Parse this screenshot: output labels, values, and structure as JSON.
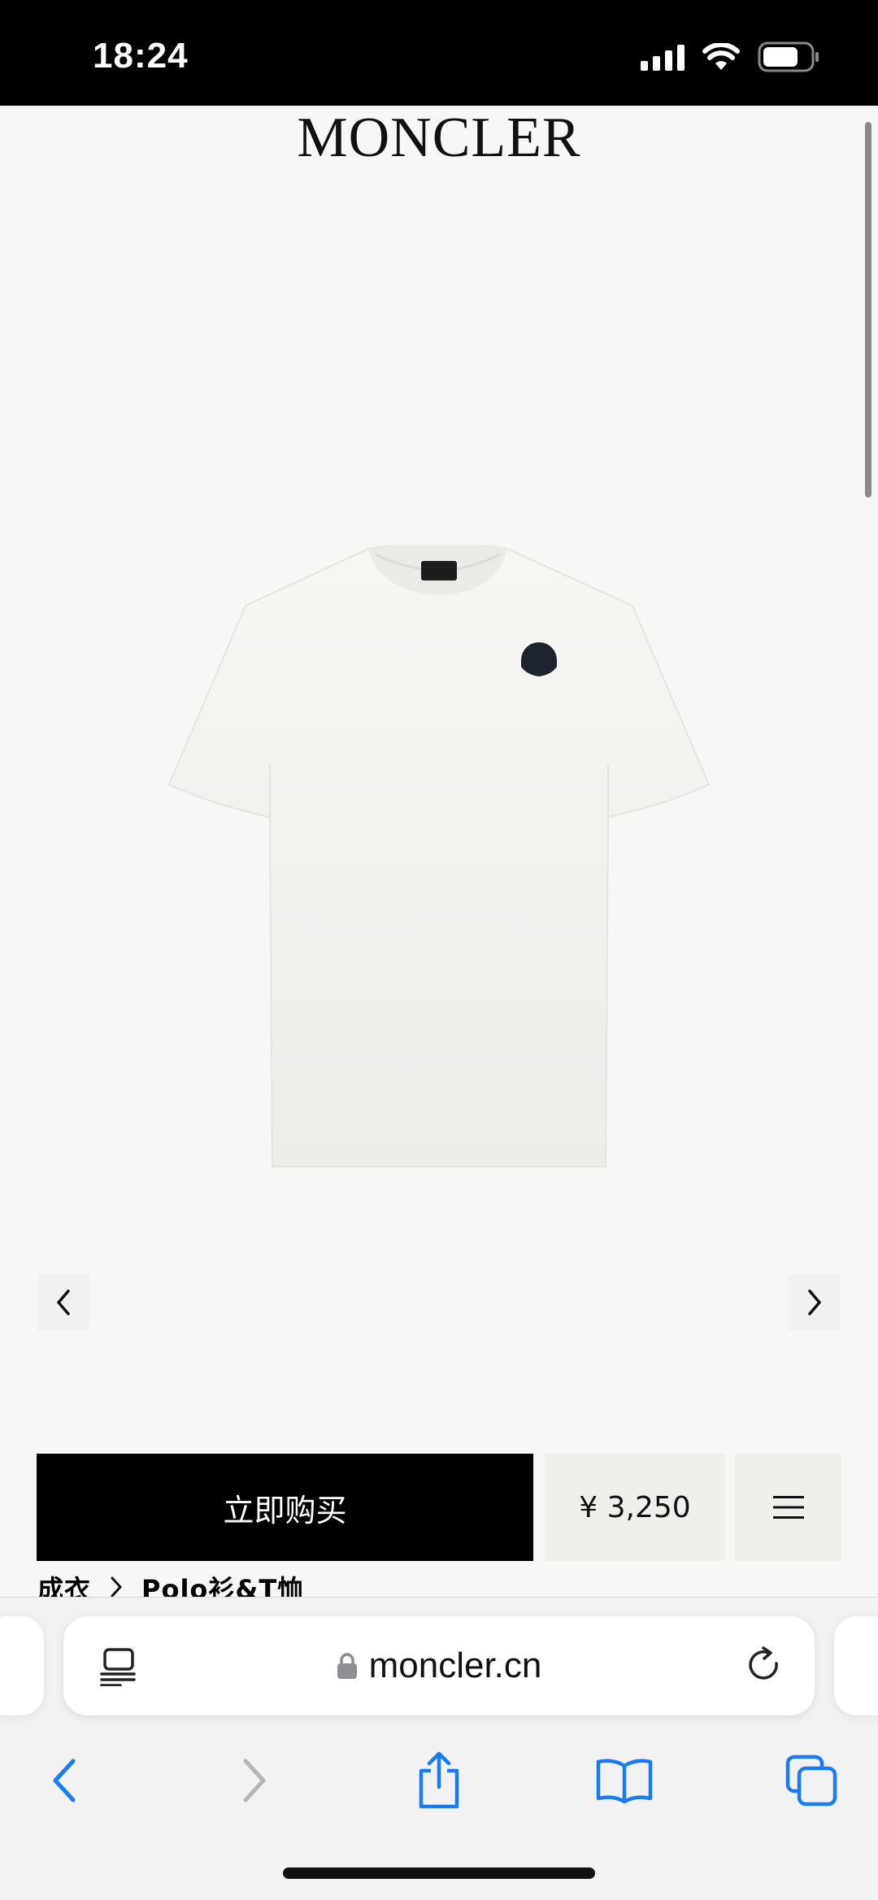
{
  "status_bar": {
    "time": "18:24",
    "icons": [
      "cellular-signal-icon",
      "wifi-icon",
      "battery-icon"
    ]
  },
  "header": {
    "brand": "MONCLER"
  },
  "product": {
    "image": "white-t-shirt-with-logo-patch",
    "carousel": {
      "prev_icon": "chevron-left-icon",
      "next_icon": "chevron-right-icon"
    }
  },
  "purchase": {
    "buy_label": "立即购买",
    "price": "¥ 3,250",
    "menu_icon": "hamburger-menu-icon"
  },
  "breadcrumb": {
    "items": [
      "成衣",
      "Polo衫&T恤"
    ],
    "separator_icon": "chevron-right-icon"
  },
  "browser": {
    "url": "moncler.cn",
    "address_icons": [
      "reader-view-icon",
      "lock-icon",
      "reload-icon"
    ],
    "toolbar": [
      "back-icon",
      "forward-icon",
      "share-icon",
      "bookmarks-icon",
      "tabs-icon"
    ],
    "colors": {
      "accent": "#1a7cf5",
      "disabled": "#b5b5b5"
    }
  }
}
